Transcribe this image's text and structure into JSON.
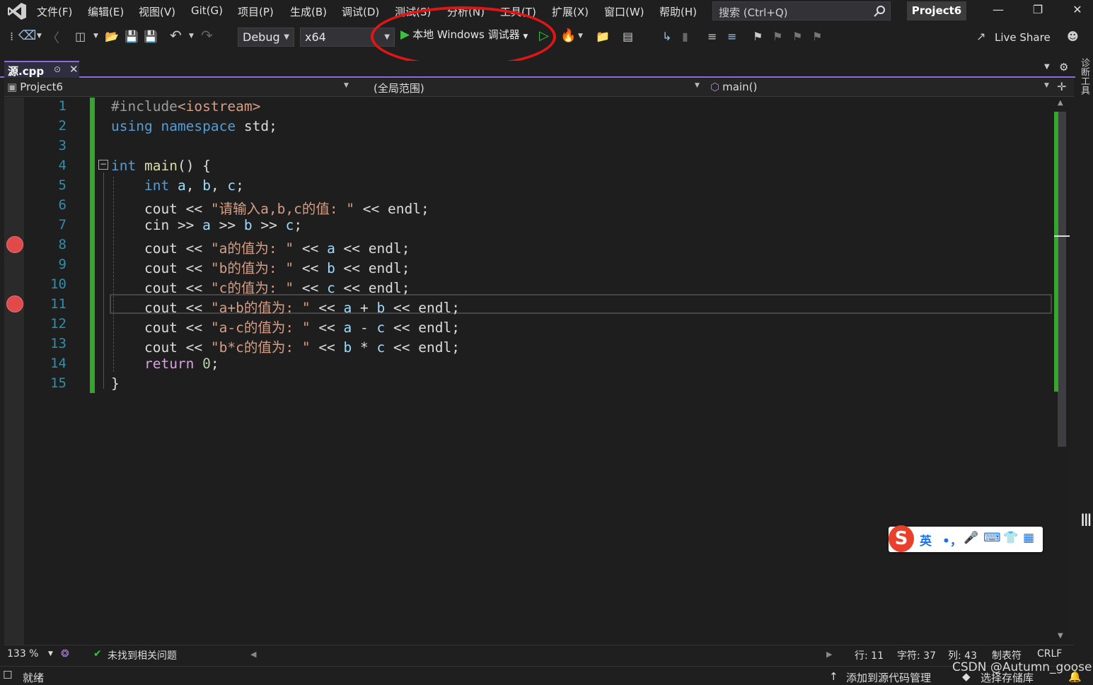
{
  "menu": {
    "items": [
      "文件(F)",
      "编辑(E)",
      "视图(V)",
      "Git(G)",
      "项目(P)",
      "生成(B)",
      "调试(D)",
      "测试(S)",
      "分析(N)",
      "工具(T)",
      "扩展(X)",
      "窗口(W)",
      "帮助(H)"
    ],
    "search_placeholder": "搜索 (Ctrl+Q)",
    "project": "Project6"
  },
  "toolbar": {
    "config": "Debug",
    "platform": "x64",
    "run_label": "本地 Windows 调试器",
    "live_share": "Live Share",
    "highlight_color": "#e01616"
  },
  "tab": {
    "file_name": "源.cpp"
  },
  "navbar": {
    "project": "Project6",
    "scope": "(全局范围)",
    "member": "main()"
  },
  "editor": {
    "line_numbers": [
      "1",
      "2",
      "3",
      "4",
      "5",
      "6",
      "7",
      "8",
      "9",
      "10",
      "11",
      "12",
      "13",
      "14",
      "15"
    ],
    "breakpoint_lines": [
      8,
      11
    ],
    "current_line": 11
  },
  "editor_status": {
    "zoom": "133 %",
    "issues": "未找到相关问题",
    "line": "行: 11",
    "char": "字符: 37",
    "col": "列: 43",
    "indent": "制表符",
    "eol": "CRLF"
  },
  "statusbar": {
    "ready": "就绪",
    "add_source_control": "添加到源代码管理",
    "select_repo": "选择存储库"
  },
  "side_tool": "诊断工具",
  "ime": {
    "logo": "S",
    "lang": "英",
    "punct": "•，"
  },
  "watermark": "CSDN @Autumn_goose"
}
